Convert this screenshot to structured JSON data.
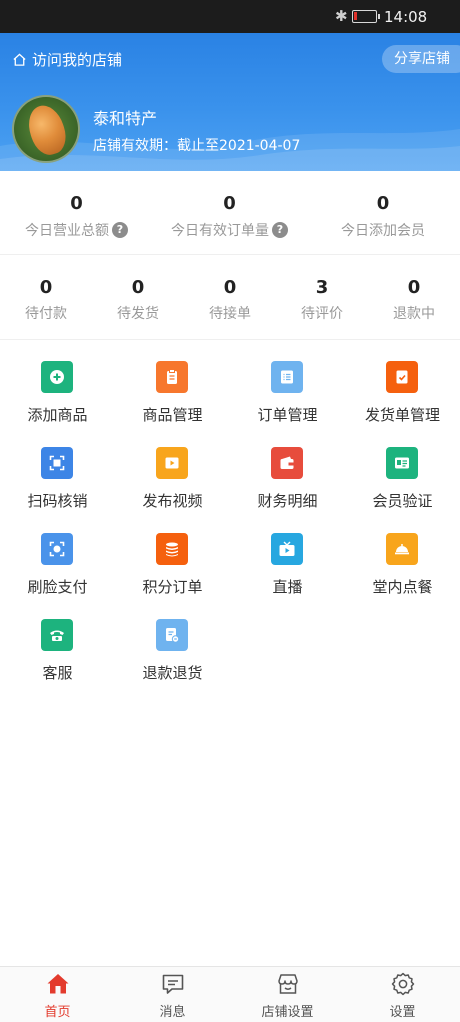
{
  "status_bar": {
    "time": "14:08",
    "bluetooth": "bluetooth-icon",
    "battery_level": 0.1,
    "battery_color": "#e0322c"
  },
  "header": {
    "visit_label": "访问我的店铺",
    "share_label": "分享店铺",
    "shop_name": "泰和特产",
    "validity": "店铺有效期：截止至2021-04-07",
    "gradient_colors": [
      "#2a82e4",
      "#4ea2f2"
    ]
  },
  "today_stats": [
    {
      "value": "0",
      "label": "今日营业总额",
      "help": true
    },
    {
      "value": "0",
      "label": "今日有效订单量",
      "help": true
    },
    {
      "value": "0",
      "label": "今日添加会员",
      "help": false
    }
  ],
  "order_stats": [
    {
      "value": "0",
      "label": "待付款"
    },
    {
      "value": "0",
      "label": "待发货"
    },
    {
      "value": "0",
      "label": "待接单"
    },
    {
      "value": "3",
      "label": "待评价"
    },
    {
      "value": "0",
      "label": "退款中"
    }
  ],
  "features": [
    {
      "label": "添加商品",
      "icon": "plus-circle-icon",
      "color": "#1db37e"
    },
    {
      "label": "商品管理",
      "icon": "clipboard-icon",
      "color": "#f7772d"
    },
    {
      "label": "订单管理",
      "icon": "list-icon",
      "color": "#6fb3ef"
    },
    {
      "label": "发货单管理",
      "icon": "check-doc-icon",
      "color": "#f5600e"
    },
    {
      "label": "扫码核销",
      "icon": "scan-icon",
      "color": "#3d85e6"
    },
    {
      "label": "发布视频",
      "icon": "video-icon",
      "color": "#f8a51c"
    },
    {
      "label": "财务明细",
      "icon": "wallet-icon",
      "color": "#e74c3c"
    },
    {
      "label": "会员验证",
      "icon": "id-card-icon",
      "color": "#1db37e"
    },
    {
      "label": "刷脸支付",
      "icon": "face-scan-icon",
      "color": "#4a93ea"
    },
    {
      "label": "积分订单",
      "icon": "coin-stack-icon",
      "color": "#f5600e"
    },
    {
      "label": "直播",
      "icon": "tv-icon",
      "color": "#27a7e0"
    },
    {
      "label": "堂内点餐",
      "icon": "dish-icon",
      "color": "#f8a51c"
    },
    {
      "label": "客服",
      "icon": "phone-icon",
      "color": "#1db37e"
    },
    {
      "label": "退款退货",
      "icon": "refund-doc-icon",
      "color": "#6fb3ef"
    }
  ],
  "tabs": [
    {
      "label": "首页",
      "icon": "home-icon",
      "active": true
    },
    {
      "label": "消息",
      "icon": "message-icon",
      "active": false
    },
    {
      "label": "店铺设置",
      "icon": "store-icon",
      "active": false
    },
    {
      "label": "设置",
      "icon": "gear-icon",
      "active": false
    }
  ],
  "accent_color": "#e33b2d"
}
